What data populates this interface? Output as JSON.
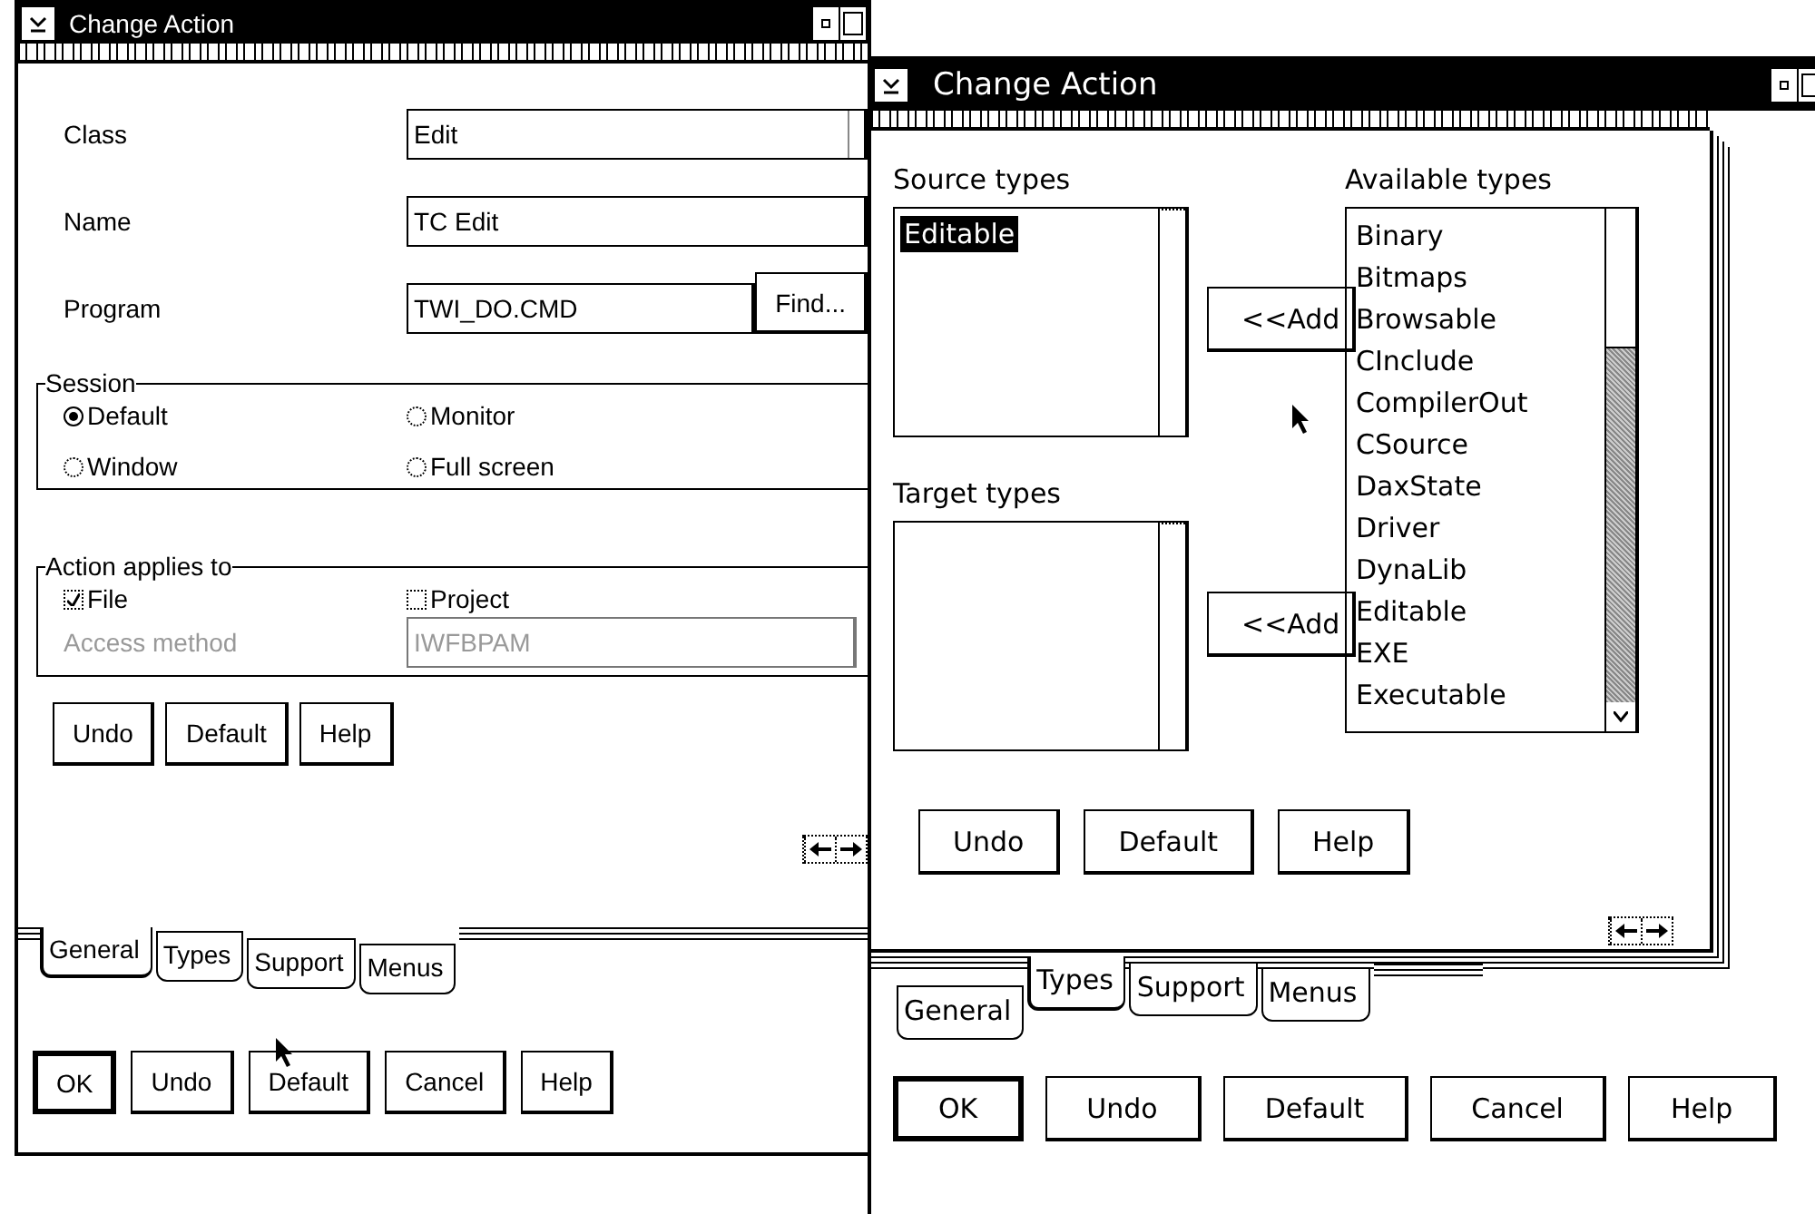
{
  "window_general": {
    "title": "Change Action",
    "fields": [
      {
        "kind": "dropdown",
        "label": "Class",
        "value": "Edit"
      },
      {
        "kind": "text",
        "label": "Name",
        "value": "TC Edit"
      },
      {
        "kind": "text_button",
        "label": "Program",
        "value": "TWI_DO.CMD",
        "button": "Find..."
      }
    ],
    "session": {
      "label": "Session",
      "options": [
        {
          "label": "Default",
          "selected": true
        },
        {
          "label": "Monitor",
          "selected": false
        },
        {
          "label": "Window",
          "selected": false
        },
        {
          "label": "Full screen",
          "selected": false
        }
      ]
    },
    "applies_to": {
      "label": "Action applies to",
      "checks": [
        {
          "label": "File",
          "checked": true
        },
        {
          "label": "Project",
          "checked": false
        }
      ],
      "access_method": {
        "label": "Access method",
        "value": "IWFBPAM",
        "disabled": true
      }
    },
    "page_buttons": [
      "Undo",
      "Default",
      "Help"
    ],
    "tabs": [
      {
        "label": "General",
        "selected": true
      },
      {
        "label": "Types",
        "selected": false
      },
      {
        "label": "Support",
        "selected": false
      },
      {
        "label": "Menus",
        "selected": false
      }
    ],
    "buttons": [
      {
        "label": "OK",
        "default": true
      },
      {
        "label": "Undo",
        "default": false
      },
      {
        "label": "Default",
        "default": false
      },
      {
        "label": "Cancel",
        "default": false
      },
      {
        "label": "Help",
        "default": false
      }
    ]
  },
  "window_types": {
    "title": "Change Action",
    "source_types": {
      "label": "Source types",
      "items": [
        {
          "label": "Editable",
          "selected": true
        }
      ]
    },
    "target_types": {
      "label": "Target types"
    },
    "add_buttons": [
      "<<Add",
      "<<Add"
    ],
    "available_types": {
      "label": "Available types",
      "items": [
        {
          "label": "Binary",
          "selected": false
        },
        {
          "label": "Bitmaps",
          "selected": false
        },
        {
          "label": "Browsable",
          "selected": false
        },
        {
          "label": "CInclude",
          "selected": false
        },
        {
          "label": "CompilerOut",
          "selected": false
        },
        {
          "label": "CSource",
          "selected": false
        },
        {
          "label": "DaxState",
          "selected": false
        },
        {
          "label": "Driver",
          "selected": false
        },
        {
          "label": "DynaLib",
          "selected": false
        },
        {
          "label": "Editable",
          "selected": false
        },
        {
          "label": "EXE",
          "selected": false
        },
        {
          "label": "Executable",
          "selected": false
        }
      ]
    },
    "page_buttons": [
      "Undo",
      "Default",
      "Help"
    ],
    "tabs": [
      {
        "label": "General",
        "selected": false
      },
      {
        "label": "Types",
        "selected": true
      },
      {
        "label": "Support",
        "selected": false
      },
      {
        "label": "Menus",
        "selected": false
      }
    ],
    "buttons": [
      {
        "label": "OK",
        "default": true
      },
      {
        "label": "Undo",
        "default": false
      },
      {
        "label": "Default",
        "default": false
      },
      {
        "label": "Cancel",
        "default": false
      },
      {
        "label": "Help",
        "default": false
      }
    ]
  }
}
